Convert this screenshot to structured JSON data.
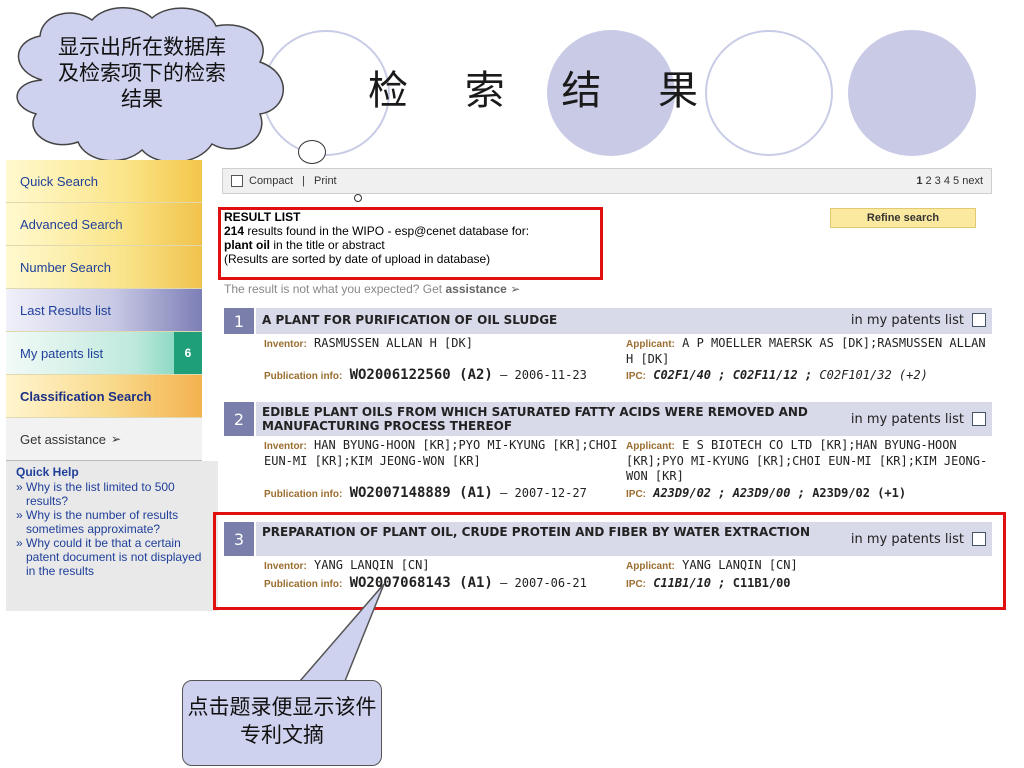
{
  "slide": {
    "title": "检 索 结 果",
    "cloud_note": "显示出所在数据库及检索项下的检索结果",
    "callout_note": "点击题录便显示该件专利文摘"
  },
  "sidebar": {
    "items": [
      {
        "label": "Quick Search"
      },
      {
        "label": "Advanced Search"
      },
      {
        "label": "Number Search"
      },
      {
        "label": "Last Results list"
      },
      {
        "label": "My patents list",
        "badge": "6"
      },
      {
        "label": "Classification Search"
      },
      {
        "label": "Get assistance"
      }
    ],
    "quick_help": {
      "title": "Quick Help",
      "items": [
        "» Why is the list limited to 500 results?",
        "» Why is the number of results sometimes approximate?",
        "» Why could it be that a certain patent document is not displayed in the results"
      ]
    }
  },
  "toolbar": {
    "compact_label": "Compact",
    "separator": "|",
    "print_label": "Print",
    "current_page": "1",
    "pages": "2 3 4 5",
    "next_label": "next"
  },
  "results": {
    "list_title": "RESULT LIST",
    "count": "214",
    "found_text": "results found in the WIPO - esp@cenet database for:",
    "query": "plant oil",
    "query_scope": "in the title or abstract",
    "sort_note": "(Results are sorted by date of upload in database)",
    "assist_text": "The result is not what you expected? Get",
    "assist_link": "assistance",
    "refine_label": "Refine search",
    "my_list_label": "in my patents list",
    "inventor_label": "Inventor:",
    "applicant_label": "Applicant:",
    "pubinfo_label": "Publication info:",
    "ipc_label": "IPC:",
    "records": [
      {
        "num": "1",
        "title": "A PLANT FOR PURIFICATION OF OIL SLUDGE",
        "inventor": "RASMUSSEN ALLAN H [DK]",
        "applicant": "A P MOELLER MAERSK AS [DK];RASMUSSEN ALLAN H [DK]",
        "pub_number": "WO2006122560 (A2)",
        "pub_date": "— 2006-11-23",
        "ipc_bold": "C02F1/40 ; C02F11/12 ;",
        "ipc_rest": "C02F101/32 (+2)"
      },
      {
        "num": "2",
        "title": "EDIBLE PLANT OILS FROM WHICH SATURATED FATTY ACIDS WERE REMOVED AND MANUFACTURING PROCESS THEREOF",
        "inventor": "HAN BYUNG-HOON [KR];PYO MI-KYUNG [KR];CHOI EUN-MI [KR];KIM JEONG-WON [KR]",
        "applicant": "E S BIOTECH CO LTD [KR];HAN BYUNG-HOON [KR];PYO MI-KYUNG [KR];CHOI EUN-MI [KR];KIM JEONG-WON [KR]",
        "pub_number": "WO2007148889 (A1)",
        "pub_date": "— 2007-12-27",
        "ipc_bold": "A23D9/02 ; A23D9/00 ;",
        "ipc_rest": "A23D9/02 (+1)"
      },
      {
        "num": "3",
        "title": "PREPARATION OF PLANT OIL, CRUDE PROTEIN AND FIBER BY WATER EXTRACTION",
        "inventor": "YANG LANQIN [CN]",
        "applicant": "YANG LANQIN [CN]",
        "pub_number": "WO2007068143 (A1)",
        "pub_date": "— 2007-06-21",
        "ipc_bold": "C11B1/10 ;",
        "ipc_rest": "C11B1/00"
      }
    ]
  }
}
